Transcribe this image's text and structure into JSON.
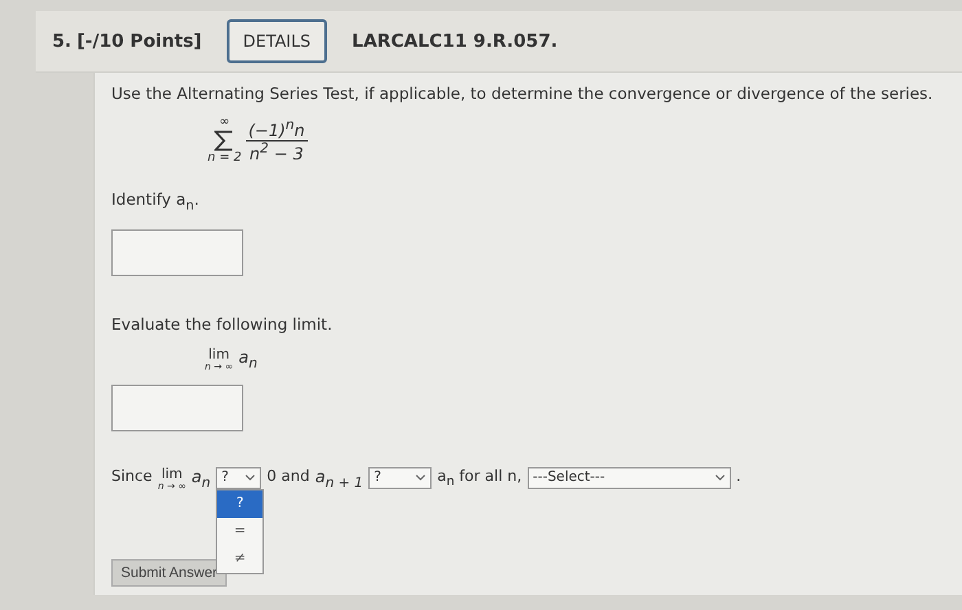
{
  "header": {
    "number": "5.",
    "points": "[-/10 Points]",
    "details_button": "DETAILS",
    "code": "LARCALC11 9.R.057."
  },
  "instructions": "Use the Alternating Series Test, if applicable, to determine the convergence or divergence of the series.",
  "series": {
    "upper": "∞",
    "lower": "n = 2",
    "numerator": "(−1)$^{n}$n",
    "denominator": "n$^{2}$ − 3"
  },
  "identify": {
    "prompt": "Identify a$_{n}$."
  },
  "limit_question": {
    "prompt": "Evaluate the following limit.",
    "lim": "lim",
    "under": "n → ∞",
    "expression": "a$_{n}$"
  },
  "conclusion": {
    "since": "Since",
    "lim": "lim",
    "under": "n → ∞",
    "expression": "a$_{n}$",
    "select_1": {
      "value": "?",
      "expanded": true,
      "options": [
        {
          "label": "?",
          "selected": true
        },
        {
          "label": "=",
          "selected": false
        },
        {
          "label": "≠",
          "selected": false
        }
      ]
    },
    "middle": "0 and",
    "term": "a$_{n + 1}$",
    "select_2": {
      "value": "?"
    },
    "after": "a$_{n}$ for all n,",
    "select_3": {
      "value": "---Select---"
    },
    "end": "."
  },
  "submit_button": "Submit Answer"
}
